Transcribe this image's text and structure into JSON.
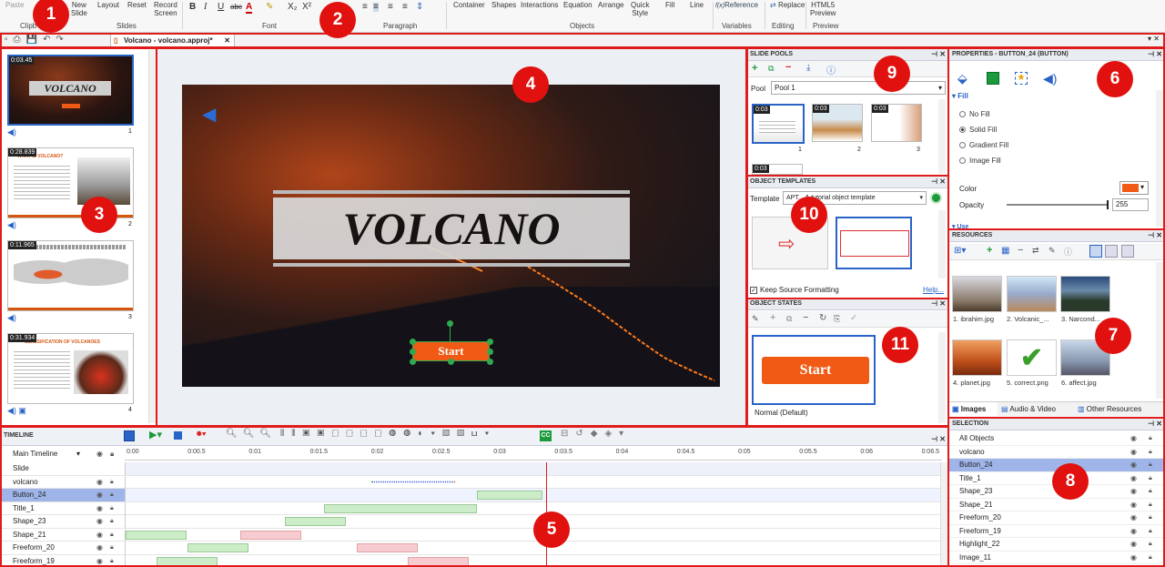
{
  "ribbon": {
    "buttons": {
      "paste": "Paste",
      "new_slide": "New\nSlide",
      "layout": "Layout",
      "reset": "Reset",
      "record": "Record\nScreen",
      "container": "Container",
      "shapes": "Shapes",
      "interactions": "Interactions",
      "equation": "Equation",
      "arrange": "Arrange",
      "quick_style": "Quick\nStyle",
      "fill": "Fill",
      "line": "Line",
      "reference": "Reference",
      "replace": "Replace",
      "html5": "HTML5\nPreview"
    },
    "groups": {
      "clipboard": "Clipb",
      "slides": "Slides",
      "font": "Font",
      "paragraph": "Paragraph",
      "objects": "Objects",
      "variables": "Variables",
      "editing": "Editing",
      "preview": "Preview"
    }
  },
  "document_tab": "Volcano - volcano.approj*",
  "callouts": [
    "1",
    "2",
    "3",
    "4",
    "5",
    "6",
    "7",
    "8",
    "9",
    "10",
    "11"
  ],
  "slides": [
    {
      "time": "0:03.45",
      "num": "1",
      "title": "VOLCANO"
    },
    {
      "time": "0:28.839",
      "num": "2",
      "title": "WHAT IS VOLCANO?"
    },
    {
      "time": "0:11.965",
      "num": "3",
      "title": ""
    },
    {
      "time": "0:31.934",
      "num": "4",
      "title": "CLASSIFICATION OF VOLCANOES"
    }
  ],
  "canvas": {
    "title": "VOLCANO",
    "button": "Start"
  },
  "slide_pools": {
    "header": "SLIDE POOLS",
    "pool_label": "Pool",
    "pool_value": "Pool 1",
    "thumbs": [
      "0:03",
      "0:03",
      "0:03",
      "0:03"
    ],
    "nums": [
      "1",
      "2",
      "3"
    ]
  },
  "object_templates": {
    "header": "OBJECT TEMPLATES",
    "template_label": "Template",
    "template_value": "APT... & tutorial object template",
    "keep": "Keep Source Formatting",
    "help": "Help..."
  },
  "object_states": {
    "header": "OBJECT STATES",
    "state_button": "Start",
    "state_name": "Normal (Default)"
  },
  "properties": {
    "header": "PROPERTIES - BUTTON_24 (BUTTON)",
    "section": "Fill",
    "options": [
      "No Fill",
      "Solid Fill",
      "Gradient Fill",
      "Image Fill"
    ],
    "selected": "Solid Fill",
    "color_label": "Color",
    "color_value": "#f05a14",
    "opacity_label": "Opacity",
    "opacity_value": "255",
    "use_label": "Use",
    "opacity_fraction": 1.0
  },
  "resources": {
    "header": "RESOURCES",
    "items": [
      "1. ibrahim.jpg",
      "2. Volcanic_...",
      "3. Narcond...",
      "4. planet.jpg",
      "5. correct.png",
      "6. affect.jpg"
    ],
    "tabs": [
      "Images",
      "Audio & Video",
      "Other Resources"
    ]
  },
  "selection": {
    "header": "SELECTION",
    "items": [
      "All Objects",
      "volcano",
      "Button_24",
      "Title_1",
      "Shape_23",
      "Shape_21",
      "Freeform_20",
      "Freeform_19",
      "Highlight_22",
      "Image_11"
    ],
    "selected": "Button_24"
  },
  "timeline": {
    "header": "TIMELINE",
    "main": "Main Timeline",
    "ruler": [
      "0:00",
      "0:00.5",
      "0:01",
      "0:01.5",
      "0:02",
      "0:02.5",
      "0:03",
      "0:03.5",
      "0:04",
      "0:04.5",
      "0:05",
      "0:05.5",
      "0:06",
      "0:06.5"
    ],
    "rows": [
      "Slide",
      "volcano",
      "Button_24",
      "Title_1",
      "Shape_23",
      "Shape_21",
      "Freeform_20",
      "Freeform_19"
    ],
    "playhead": "0:03.45"
  },
  "colors": {
    "accent_red": "#e01b1b",
    "button_orange": "#f05a14",
    "selection_blue": "#9fb5e9"
  }
}
